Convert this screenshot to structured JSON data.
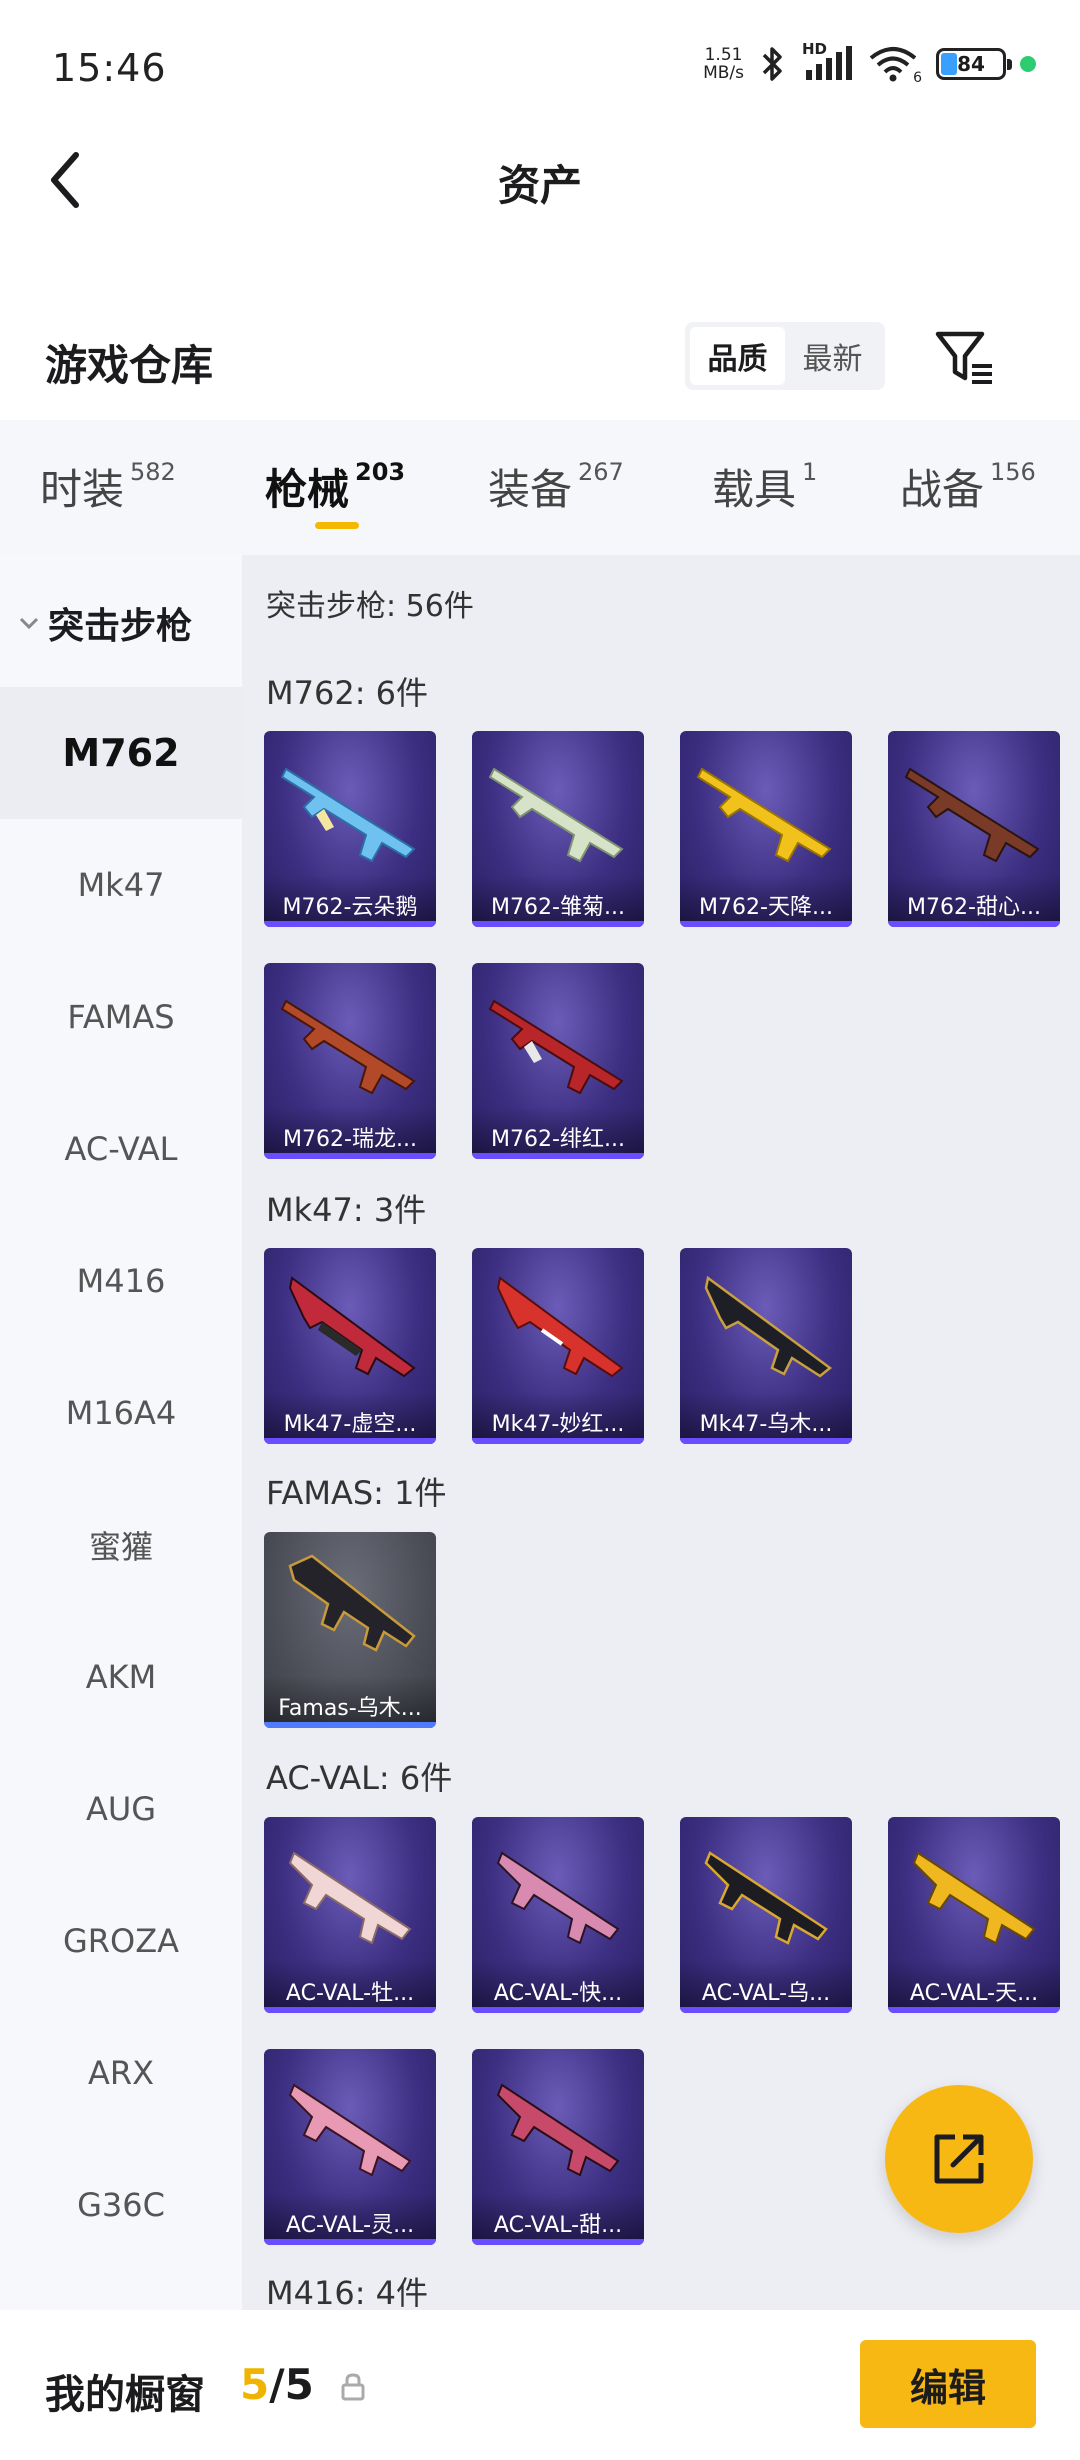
{
  "status_bar": {
    "time": "15:46",
    "net_speed_value": "1.51",
    "net_speed_unit": "MB/s",
    "network_type": "HD",
    "wifi_level": "6",
    "battery": "84"
  },
  "header": {
    "title": "资产"
  },
  "warehouse": {
    "title": "游戏仓库",
    "sort_options": [
      "品质",
      "最新"
    ],
    "active_sort": "品质"
  },
  "tabs": [
    {
      "label": "时装",
      "count": "582"
    },
    {
      "label": "枪械",
      "count": "203"
    },
    {
      "label": "装备",
      "count": "267"
    },
    {
      "label": "载具",
      "count": "1"
    },
    {
      "label": "战备",
      "count": "156"
    }
  ],
  "active_tab": "枪械",
  "sidebar": {
    "category": "突击步枪",
    "items": [
      "M762",
      "Mk47",
      "FAMAS",
      "AC-VAL",
      "M416",
      "M16A4",
      "蜜獾",
      "AKM",
      "AUG",
      "GROZA",
      "ARX",
      "G36C"
    ],
    "active_item": "M762"
  },
  "content": {
    "summary": "突击步枪: 56件",
    "groups": [
      {
        "title": "M762: 6件",
        "items": [
          "M762-云朵鹅",
          "M762-雏菊...",
          "M762-天降...",
          "M762-甜心...",
          "M762-瑞龙...",
          "M762-绯红..."
        ]
      },
      {
        "title": "Mk47: 3件",
        "items": [
          "Mk47-虚空...",
          "Mk47-妙红...",
          "Mk47-乌木..."
        ]
      },
      {
        "title": "FAMAS: 1件",
        "items": [
          "Famas-乌木..."
        ]
      },
      {
        "title": "AC-VAL: 6件",
        "items": [
          "AC-VAL-牡...",
          "AC-VAL-快...",
          "AC-VAL-乌...",
          "AC-VAL-天...",
          "AC-VAL-灵...",
          "AC-VAL-甜..."
        ]
      },
      {
        "title": "M416: 4件",
        "items": []
      }
    ]
  },
  "bottom_bar": {
    "showcase_label": "我的橱窗",
    "showcase_used": "5",
    "showcase_total": "/5",
    "edit_label": "编辑"
  },
  "colors": {
    "accent": "#f8b814",
    "card_purple": "#3d2f82",
    "card_gray": "#4c4e58"
  }
}
